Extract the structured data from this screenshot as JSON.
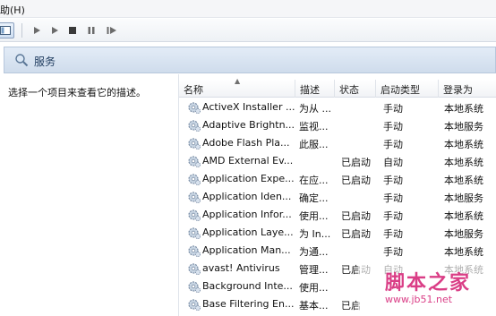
{
  "menubar": {
    "help_label": "助(H)"
  },
  "toolbar": {
    "buttons": [
      "console-tree-button",
      "start-button",
      "start-alt-button",
      "stop-button",
      "pause-button",
      "restart-button"
    ]
  },
  "banner": {
    "title": "服务",
    "icon": "magnifier-icon"
  },
  "description_pane": {
    "text": "选择一个项目来查看它的描述。"
  },
  "columns": {
    "name": "名称",
    "description": "描述",
    "status": "状态",
    "startup_type": "启动类型",
    "logon_as": "登录为"
  },
  "services": [
    {
      "name": "ActiveX Installer ...",
      "description": "为从 ...",
      "status": "",
      "startup_type": "手动",
      "logon_as": "本地系统"
    },
    {
      "name": "Adaptive Brightn...",
      "description": "监视...",
      "status": "",
      "startup_type": "手动",
      "logon_as": "本地服务"
    },
    {
      "name": "Adobe Flash Pla...",
      "description": "此服...",
      "status": "",
      "startup_type": "手动",
      "logon_as": "本地系统"
    },
    {
      "name": "AMD External Ev...",
      "description": "",
      "status": "已启动",
      "startup_type": "自动",
      "logon_as": "本地系统"
    },
    {
      "name": "Application Expe...",
      "description": "在应...",
      "status": "已启动",
      "startup_type": "手动",
      "logon_as": "本地系统"
    },
    {
      "name": "Application Iden...",
      "description": "确定...",
      "status": "",
      "startup_type": "手动",
      "logon_as": "本地服务"
    },
    {
      "name": "Application Infor...",
      "description": "使用...",
      "status": "已启动",
      "startup_type": "手动",
      "logon_as": "本地系统"
    },
    {
      "name": "Application Laye...",
      "description": "为 In...",
      "status": "已启动",
      "startup_type": "手动",
      "logon_as": "本地服务"
    },
    {
      "name": "Application Man...",
      "description": "为通...",
      "status": "",
      "startup_type": "手动",
      "logon_as": "本地系统"
    },
    {
      "name": "avast! Antivirus",
      "description": "管理...",
      "status": "已启动",
      "startup_type": "自动",
      "logon_as": "本地系统"
    },
    {
      "name": "Background Inte...",
      "description": "使用...",
      "status": "",
      "startup_type": "",
      "logon_as": ""
    },
    {
      "name": "Base Filtering En...",
      "description": "基本...",
      "status": "已启",
      "startup_type": "",
      "logon_as": ""
    }
  ],
  "watermark": {
    "text": "脚本之家",
    "url": "www.jb51.net"
  },
  "colors": {
    "banner_text": "#1e3b5e",
    "watermark": "#d62a7a"
  }
}
